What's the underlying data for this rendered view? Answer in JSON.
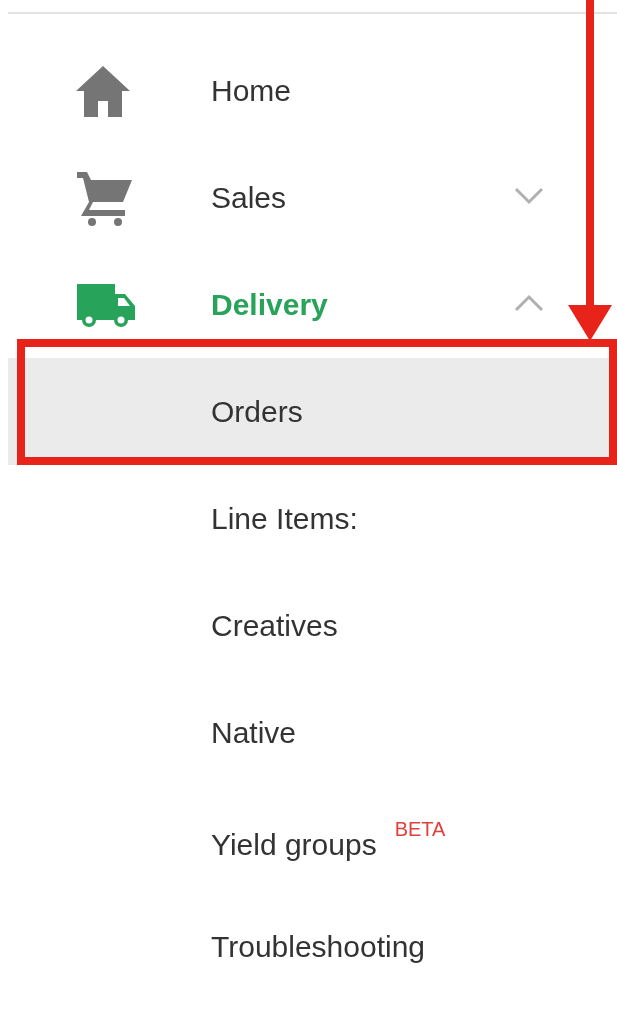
{
  "nav": {
    "items": [
      {
        "kind": "section",
        "label": "Home",
        "active": false
      },
      {
        "kind": "section",
        "label": "Sales",
        "active": false,
        "expanded": false
      },
      {
        "kind": "section",
        "label": "Delivery",
        "active": true,
        "expanded": true
      },
      {
        "kind": "subitem",
        "label": "Orders",
        "selected": true,
        "framed": true
      },
      {
        "kind": "subitem",
        "label": "Line Items:",
        "selected": false
      },
      {
        "kind": "subitem",
        "label": "Creatives",
        "selected": false
      },
      {
        "kind": "subitem",
        "label": "Native",
        "selected": false
      },
      {
        "kind": "subitem",
        "label": "Yield groups",
        "badge": "BETA",
        "selected": false
      },
      {
        "kind": "subitem",
        "label": "Troubleshooting",
        "selected": false
      }
    ]
  }
}
